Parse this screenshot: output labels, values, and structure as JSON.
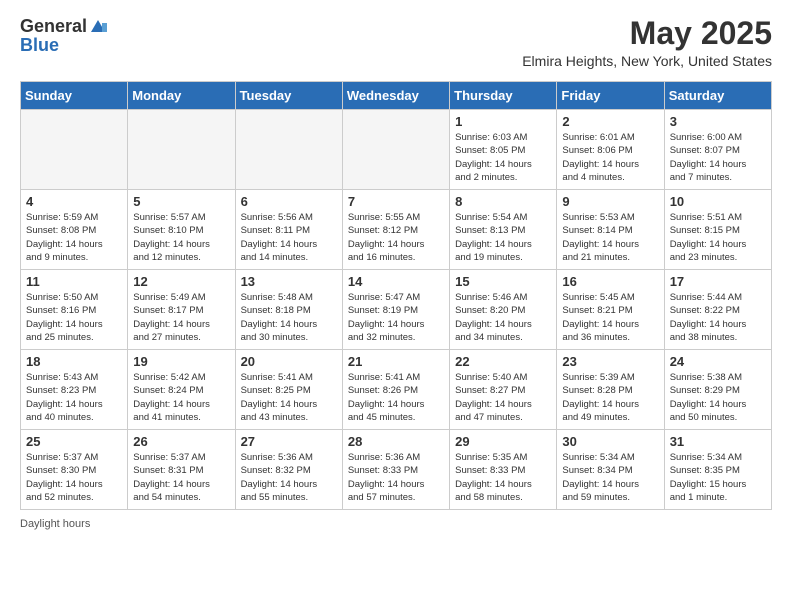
{
  "header": {
    "logo_general": "General",
    "logo_blue": "Blue",
    "month_year": "May 2025",
    "location": "Elmira Heights, New York, United States"
  },
  "days_of_week": [
    "Sunday",
    "Monday",
    "Tuesday",
    "Wednesday",
    "Thursday",
    "Friday",
    "Saturday"
  ],
  "weeks": [
    [
      {
        "day": "",
        "info": ""
      },
      {
        "day": "",
        "info": ""
      },
      {
        "day": "",
        "info": ""
      },
      {
        "day": "",
        "info": ""
      },
      {
        "day": "1",
        "info": "Sunrise: 6:03 AM\nSunset: 8:05 PM\nDaylight: 14 hours\nand 2 minutes."
      },
      {
        "day": "2",
        "info": "Sunrise: 6:01 AM\nSunset: 8:06 PM\nDaylight: 14 hours\nand 4 minutes."
      },
      {
        "day": "3",
        "info": "Sunrise: 6:00 AM\nSunset: 8:07 PM\nDaylight: 14 hours\nand 7 minutes."
      }
    ],
    [
      {
        "day": "4",
        "info": "Sunrise: 5:59 AM\nSunset: 8:08 PM\nDaylight: 14 hours\nand 9 minutes."
      },
      {
        "day": "5",
        "info": "Sunrise: 5:57 AM\nSunset: 8:10 PM\nDaylight: 14 hours\nand 12 minutes."
      },
      {
        "day": "6",
        "info": "Sunrise: 5:56 AM\nSunset: 8:11 PM\nDaylight: 14 hours\nand 14 minutes."
      },
      {
        "day": "7",
        "info": "Sunrise: 5:55 AM\nSunset: 8:12 PM\nDaylight: 14 hours\nand 16 minutes."
      },
      {
        "day": "8",
        "info": "Sunrise: 5:54 AM\nSunset: 8:13 PM\nDaylight: 14 hours\nand 19 minutes."
      },
      {
        "day": "9",
        "info": "Sunrise: 5:53 AM\nSunset: 8:14 PM\nDaylight: 14 hours\nand 21 minutes."
      },
      {
        "day": "10",
        "info": "Sunrise: 5:51 AM\nSunset: 8:15 PM\nDaylight: 14 hours\nand 23 minutes."
      }
    ],
    [
      {
        "day": "11",
        "info": "Sunrise: 5:50 AM\nSunset: 8:16 PM\nDaylight: 14 hours\nand 25 minutes."
      },
      {
        "day": "12",
        "info": "Sunrise: 5:49 AM\nSunset: 8:17 PM\nDaylight: 14 hours\nand 27 minutes."
      },
      {
        "day": "13",
        "info": "Sunrise: 5:48 AM\nSunset: 8:18 PM\nDaylight: 14 hours\nand 30 minutes."
      },
      {
        "day": "14",
        "info": "Sunrise: 5:47 AM\nSunset: 8:19 PM\nDaylight: 14 hours\nand 32 minutes."
      },
      {
        "day": "15",
        "info": "Sunrise: 5:46 AM\nSunset: 8:20 PM\nDaylight: 14 hours\nand 34 minutes."
      },
      {
        "day": "16",
        "info": "Sunrise: 5:45 AM\nSunset: 8:21 PM\nDaylight: 14 hours\nand 36 minutes."
      },
      {
        "day": "17",
        "info": "Sunrise: 5:44 AM\nSunset: 8:22 PM\nDaylight: 14 hours\nand 38 minutes."
      }
    ],
    [
      {
        "day": "18",
        "info": "Sunrise: 5:43 AM\nSunset: 8:23 PM\nDaylight: 14 hours\nand 40 minutes."
      },
      {
        "day": "19",
        "info": "Sunrise: 5:42 AM\nSunset: 8:24 PM\nDaylight: 14 hours\nand 41 minutes."
      },
      {
        "day": "20",
        "info": "Sunrise: 5:41 AM\nSunset: 8:25 PM\nDaylight: 14 hours\nand 43 minutes."
      },
      {
        "day": "21",
        "info": "Sunrise: 5:41 AM\nSunset: 8:26 PM\nDaylight: 14 hours\nand 45 minutes."
      },
      {
        "day": "22",
        "info": "Sunrise: 5:40 AM\nSunset: 8:27 PM\nDaylight: 14 hours\nand 47 minutes."
      },
      {
        "day": "23",
        "info": "Sunrise: 5:39 AM\nSunset: 8:28 PM\nDaylight: 14 hours\nand 49 minutes."
      },
      {
        "day": "24",
        "info": "Sunrise: 5:38 AM\nSunset: 8:29 PM\nDaylight: 14 hours\nand 50 minutes."
      }
    ],
    [
      {
        "day": "25",
        "info": "Sunrise: 5:37 AM\nSunset: 8:30 PM\nDaylight: 14 hours\nand 52 minutes."
      },
      {
        "day": "26",
        "info": "Sunrise: 5:37 AM\nSunset: 8:31 PM\nDaylight: 14 hours\nand 54 minutes."
      },
      {
        "day": "27",
        "info": "Sunrise: 5:36 AM\nSunset: 8:32 PM\nDaylight: 14 hours\nand 55 minutes."
      },
      {
        "day": "28",
        "info": "Sunrise: 5:36 AM\nSunset: 8:33 PM\nDaylight: 14 hours\nand 57 minutes."
      },
      {
        "day": "29",
        "info": "Sunrise: 5:35 AM\nSunset: 8:33 PM\nDaylight: 14 hours\nand 58 minutes."
      },
      {
        "day": "30",
        "info": "Sunrise: 5:34 AM\nSunset: 8:34 PM\nDaylight: 14 hours\nand 59 minutes."
      },
      {
        "day": "31",
        "info": "Sunrise: 5:34 AM\nSunset: 8:35 PM\nDaylight: 15 hours\nand 1 minute."
      }
    ]
  ],
  "footer": {
    "daylight_hours_label": "Daylight hours"
  }
}
